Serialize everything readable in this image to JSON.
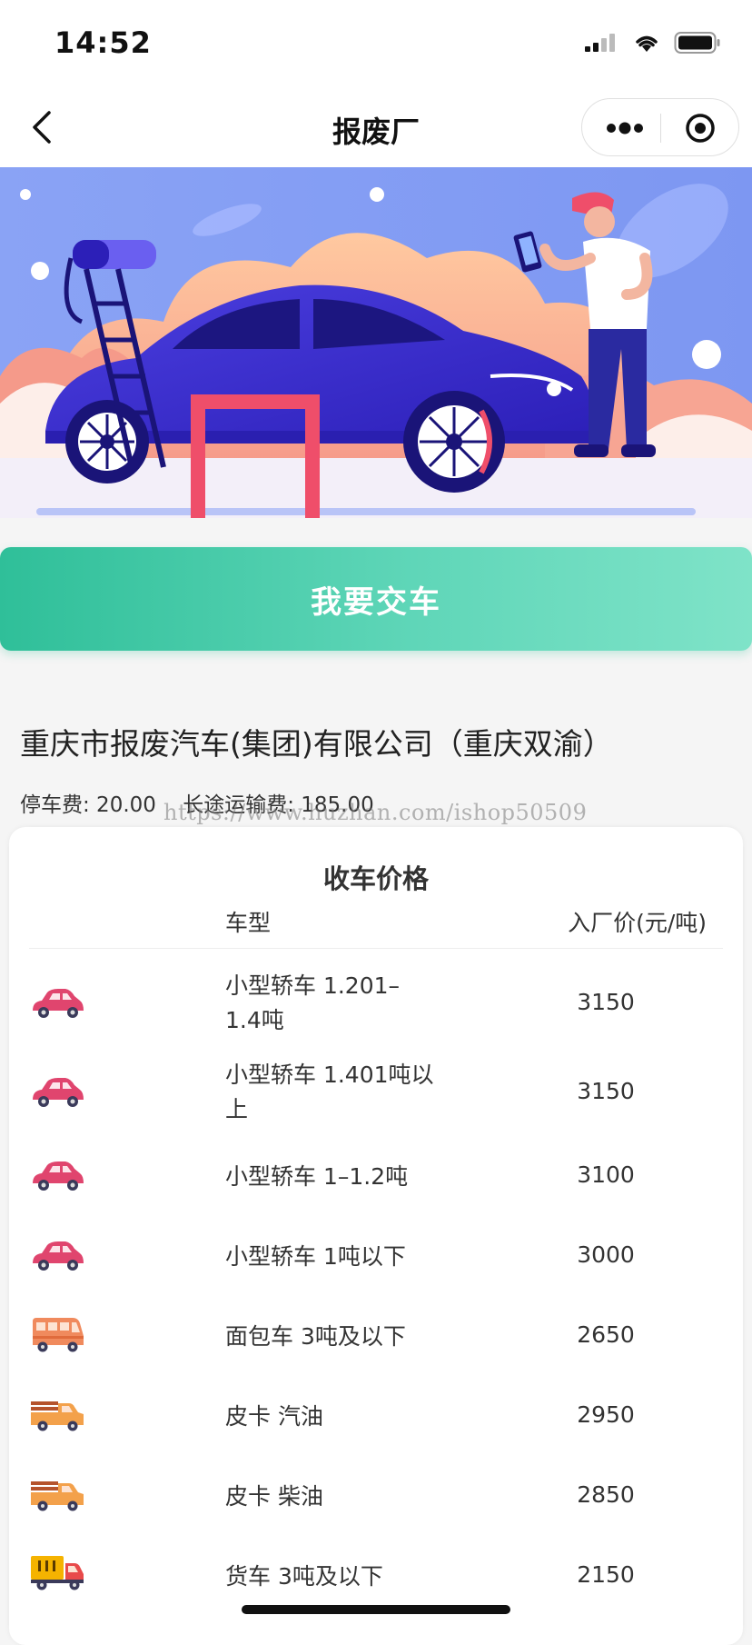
{
  "status": {
    "time": "14:52"
  },
  "nav": {
    "title": "报废厂",
    "icons": [
      "back-icon",
      "more-icon",
      "target-icon"
    ]
  },
  "action": {
    "submit_label": "我要交车"
  },
  "company": {
    "name": "重庆市报废汽车(集团)有限公司（重庆双渝）",
    "parking_fee": "停车费: 20.00",
    "transport_fee": "长途运输费: 185.00"
  },
  "watermark": "https://www.huzhan.com/ishop50509",
  "price_table": {
    "title": "收车价格",
    "col_type": "车型",
    "col_price": "入厂价(元/吨)",
    "rows": [
      {
        "icon": "sedan-icon",
        "type": "小型轿车 1.201–1.4吨",
        "price": "3150"
      },
      {
        "icon": "sedan-icon",
        "type": "小型轿车 1.401吨以上",
        "price": "3150"
      },
      {
        "icon": "sedan-icon",
        "type": "小型轿车 1–1.2吨",
        "price": "3100"
      },
      {
        "icon": "sedan-icon",
        "type": "小型轿车 1吨以下",
        "price": "3000"
      },
      {
        "icon": "van-icon",
        "type": "面包车 3吨及以下",
        "price": "2650"
      },
      {
        "icon": "pickup-icon",
        "type": "皮卡 汽油",
        "price": "2950"
      },
      {
        "icon": "pickup-icon",
        "type": "皮卡 柴油",
        "price": "2850"
      },
      {
        "icon": "truck-icon",
        "type": "货车 3吨及以下",
        "price": "2150"
      }
    ]
  },
  "colors": {
    "accent_start": "#2fbf99",
    "accent_end": "#7fe3c8",
    "sedan": "#e0456e",
    "van": "#f08a5d",
    "truck": "#f5b300"
  }
}
